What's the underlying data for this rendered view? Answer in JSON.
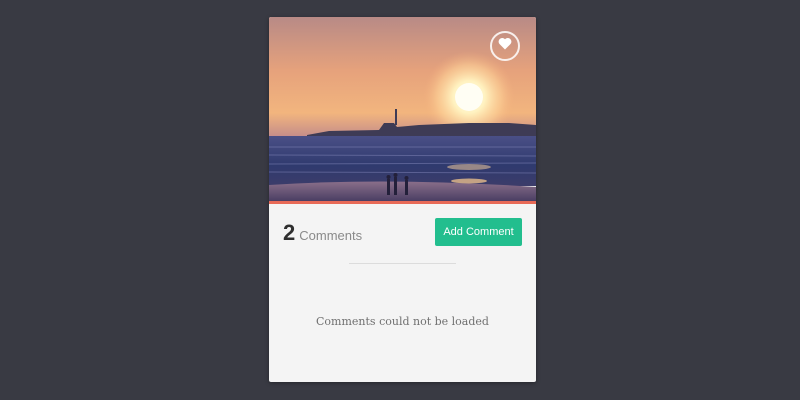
{
  "colors": {
    "background": "#393a43",
    "card": "#f4f4f4",
    "accent_line": "#e86a57",
    "button": "#22be8e",
    "button_text": "#ffffff"
  },
  "photo": {
    "icon": "sunset-beach-photo"
  },
  "favorite": {
    "icon": "heart-icon"
  },
  "comments": {
    "count": "2",
    "label": "Comments",
    "add_button_label": "Add Comment",
    "status_message": "Comments could not be loaded"
  }
}
